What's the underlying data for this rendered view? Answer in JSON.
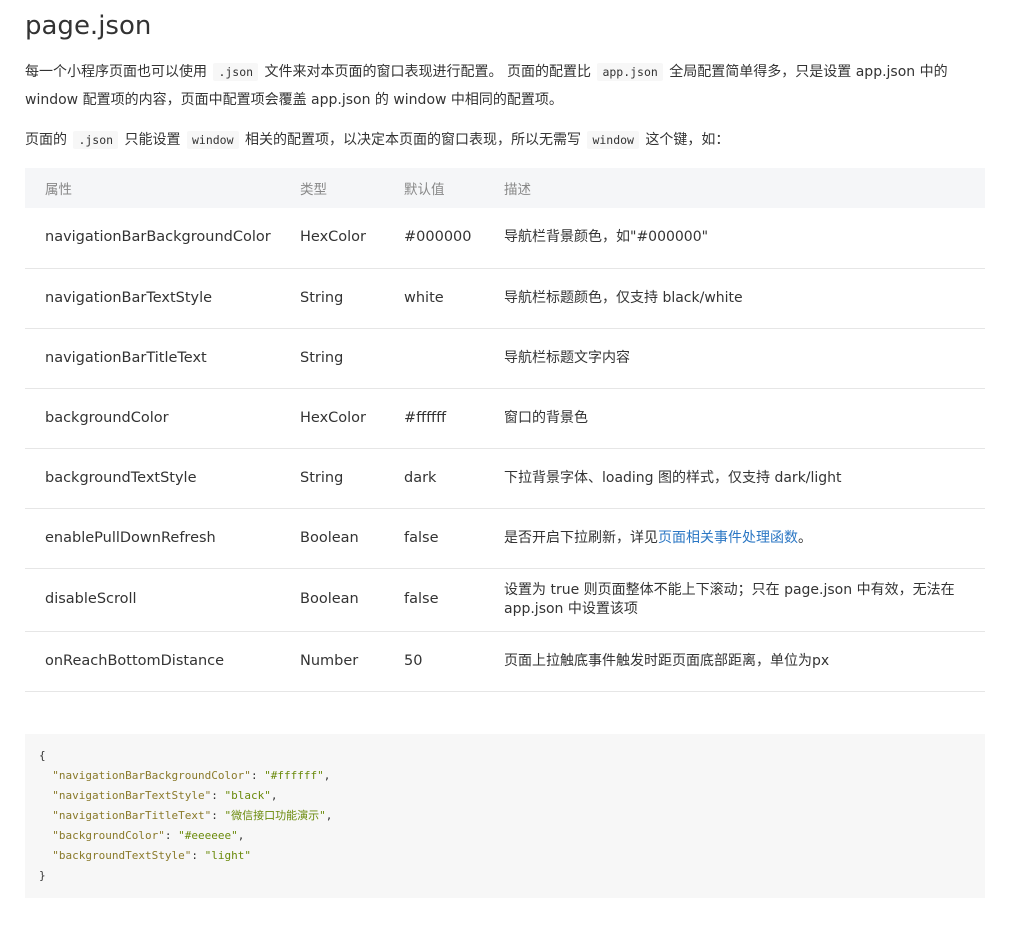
{
  "title": "page.json",
  "intro": {
    "p1": {
      "t1": "每一个小程序页面也可以使用 ",
      "c1": ".json",
      "t2": " 文件来对本页面的窗口表现进行配置。 页面的配置比 ",
      "c2": "app.json",
      "t3": " 全局配置简单得多，只是设置 app.json 中的 window 配置项的内容，页面中配置项会覆盖 app.json 的 window 中相同的配置项。"
    },
    "p2": {
      "t1": "页面的 ",
      "c1": ".json",
      "t2": " 只能设置 ",
      "c2": "window",
      "t3": " 相关的配置项，以决定本页面的窗口表现，所以无需写 ",
      "c3": "window",
      "t4": " 这个键，如："
    }
  },
  "table": {
    "headers": [
      "属性",
      "类型",
      "默认值",
      "描述"
    ],
    "rows": [
      {
        "name": "navigationBarBackgroundColor",
        "type": "HexColor",
        "default": "#000000",
        "desc": "导航栏背景颜色，如\"#000000\""
      },
      {
        "name": "navigationBarTextStyle",
        "type": "String",
        "default": "white",
        "desc": "导航栏标题颜色，仅支持 black/white"
      },
      {
        "name": "navigationBarTitleText",
        "type": "String",
        "default": "",
        "desc": "导航栏标题文字内容"
      },
      {
        "name": "backgroundColor",
        "type": "HexColor",
        "default": "#ffffff",
        "desc": "窗口的背景色"
      },
      {
        "name": "backgroundTextStyle",
        "type": "String",
        "default": "dark",
        "desc": "下拉背景字体、loading 图的样式，仅支持 dark/light"
      },
      {
        "name": "enablePullDownRefresh",
        "type": "Boolean",
        "default": "false",
        "desc_before": "是否开启下拉刷新，详见",
        "desc_link": "页面相关事件处理函数",
        "desc_after": "。"
      },
      {
        "name": "disableScroll",
        "type": "Boolean",
        "default": "false",
        "desc": "设置为 true 则页面整体不能上下滚动；只在 page.json 中有效，无法在 app.json 中设置该项"
      },
      {
        "name": "onReachBottomDistance",
        "type": "Number",
        "default": "50",
        "desc": "页面上拉触底事件触发时距页面底部距离，单位为px"
      }
    ]
  },
  "code": {
    "open": "{",
    "entries": [
      {
        "key": "\"navigationBarBackgroundColor\"",
        "value": "\"#ffffff\"",
        "comma": ","
      },
      {
        "key": "\"navigationBarTextStyle\"",
        "value": "\"black\"",
        "comma": ","
      },
      {
        "key": "\"navigationBarTitleText\"",
        "value": "\"微信接口功能演示\"",
        "comma": ","
      },
      {
        "key": "\"backgroundColor\"",
        "value": "\"#eeeeee\"",
        "comma": ","
      },
      {
        "key": "\"backgroundTextStyle\"",
        "value": "\"light\"",
        "comma": ""
      }
    ],
    "close": "}"
  },
  "colors": {
    "link": "#2b77c4",
    "table_header_bg": "#f5f6f8",
    "code_bg": "#f7f7f7",
    "code_key": "#8a7a2a",
    "code_string": "#6a8a0a"
  }
}
